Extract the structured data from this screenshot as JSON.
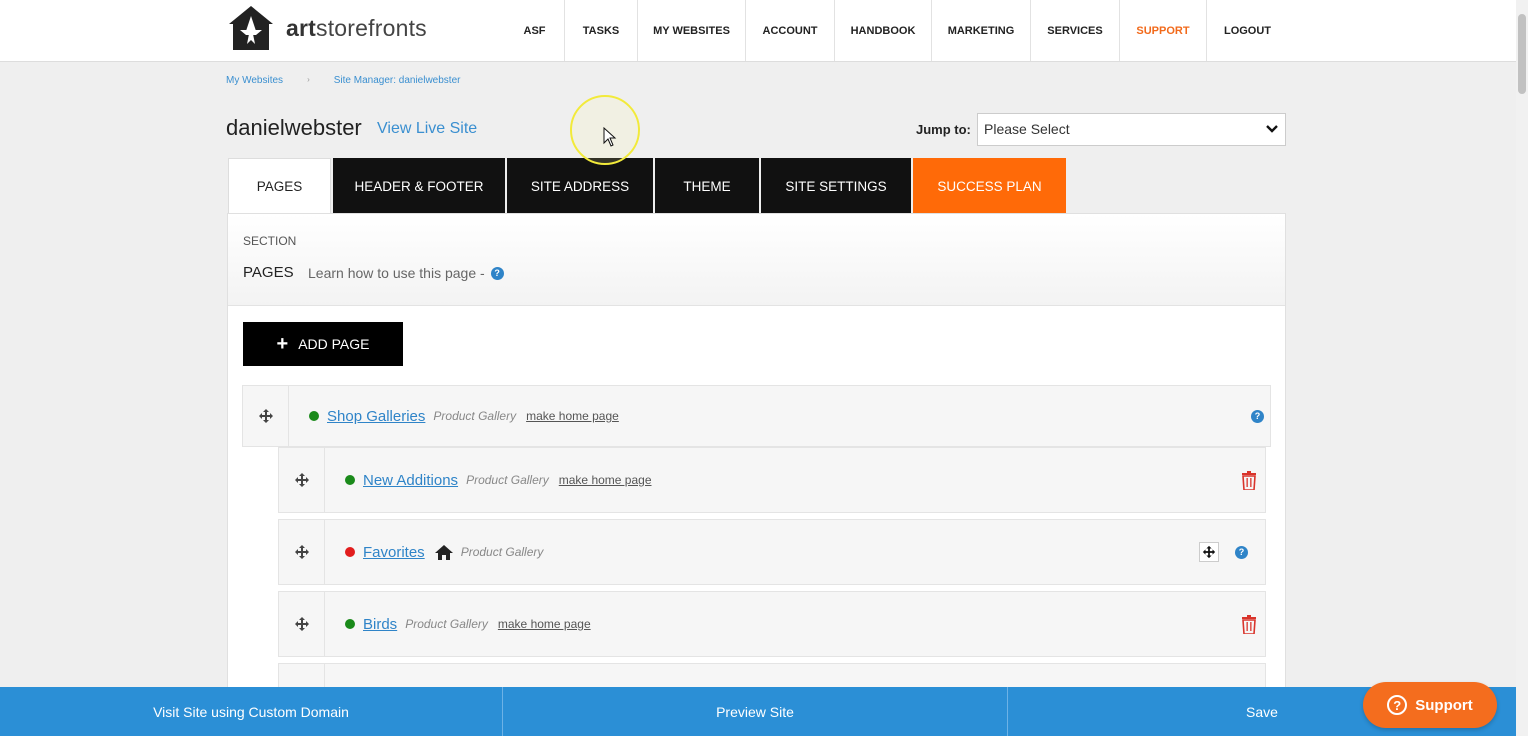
{
  "brand": {
    "logo_bold": "art",
    "logo_rest": "storefronts"
  },
  "nav": [
    {
      "label": "ASF"
    },
    {
      "label": "TASKS"
    },
    {
      "label": "MY WEBSITES"
    },
    {
      "label": "ACCOUNT"
    },
    {
      "label": "HANDBOOK"
    },
    {
      "label": "MARKETING"
    },
    {
      "label": "SERVICES"
    },
    {
      "label": "SUPPORT"
    },
    {
      "label": "LOGOUT"
    }
  ],
  "breadcrumb": {
    "first": "My Websites",
    "separator": "›",
    "second": "Site Manager: danielwebster"
  },
  "site": {
    "name": "danielwebster",
    "view_live": "View Live Site"
  },
  "jump": {
    "label": "Jump to:",
    "selected": "Please Select"
  },
  "tabs": [
    {
      "label": "PAGES"
    },
    {
      "label": "HEADER & FOOTER"
    },
    {
      "label": "SITE ADDRESS"
    },
    {
      "label": "THEME"
    },
    {
      "label": "SITE SETTINGS"
    },
    {
      "label": "SUCCESS PLAN"
    }
  ],
  "section": {
    "kicker": "SECTION",
    "name": "PAGES",
    "help_text": "Learn how to use this page -",
    "help_icon": "question-circle-icon"
  },
  "add_page": {
    "label": "ADD PAGE",
    "icon": "plus-icon"
  },
  "pages": [
    {
      "name": "Shop Galleries",
      "type": "Product Gallery",
      "status": "green",
      "action": "make home page"
    },
    {
      "name": "New Additions",
      "type": "Product Gallery",
      "status": "green",
      "action": "make home page"
    },
    {
      "name": "Favorites",
      "type": "Product Gallery",
      "status": "red",
      "is_home": true
    },
    {
      "name": "Birds",
      "type": "Product Gallery",
      "status": "green",
      "action": "make home page"
    }
  ],
  "bottom": {
    "custom_domain": "Visit Site using Custom Domain",
    "preview": "Preview Site",
    "save": "Save"
  },
  "support_button": {
    "label": "Support"
  },
  "colors": {
    "accent_blue": "#2b8fd6",
    "orange": "#ff6a08",
    "status_green": "#1a8a1a",
    "status_red": "#e21d1d",
    "delete_red": "#d9342b"
  }
}
